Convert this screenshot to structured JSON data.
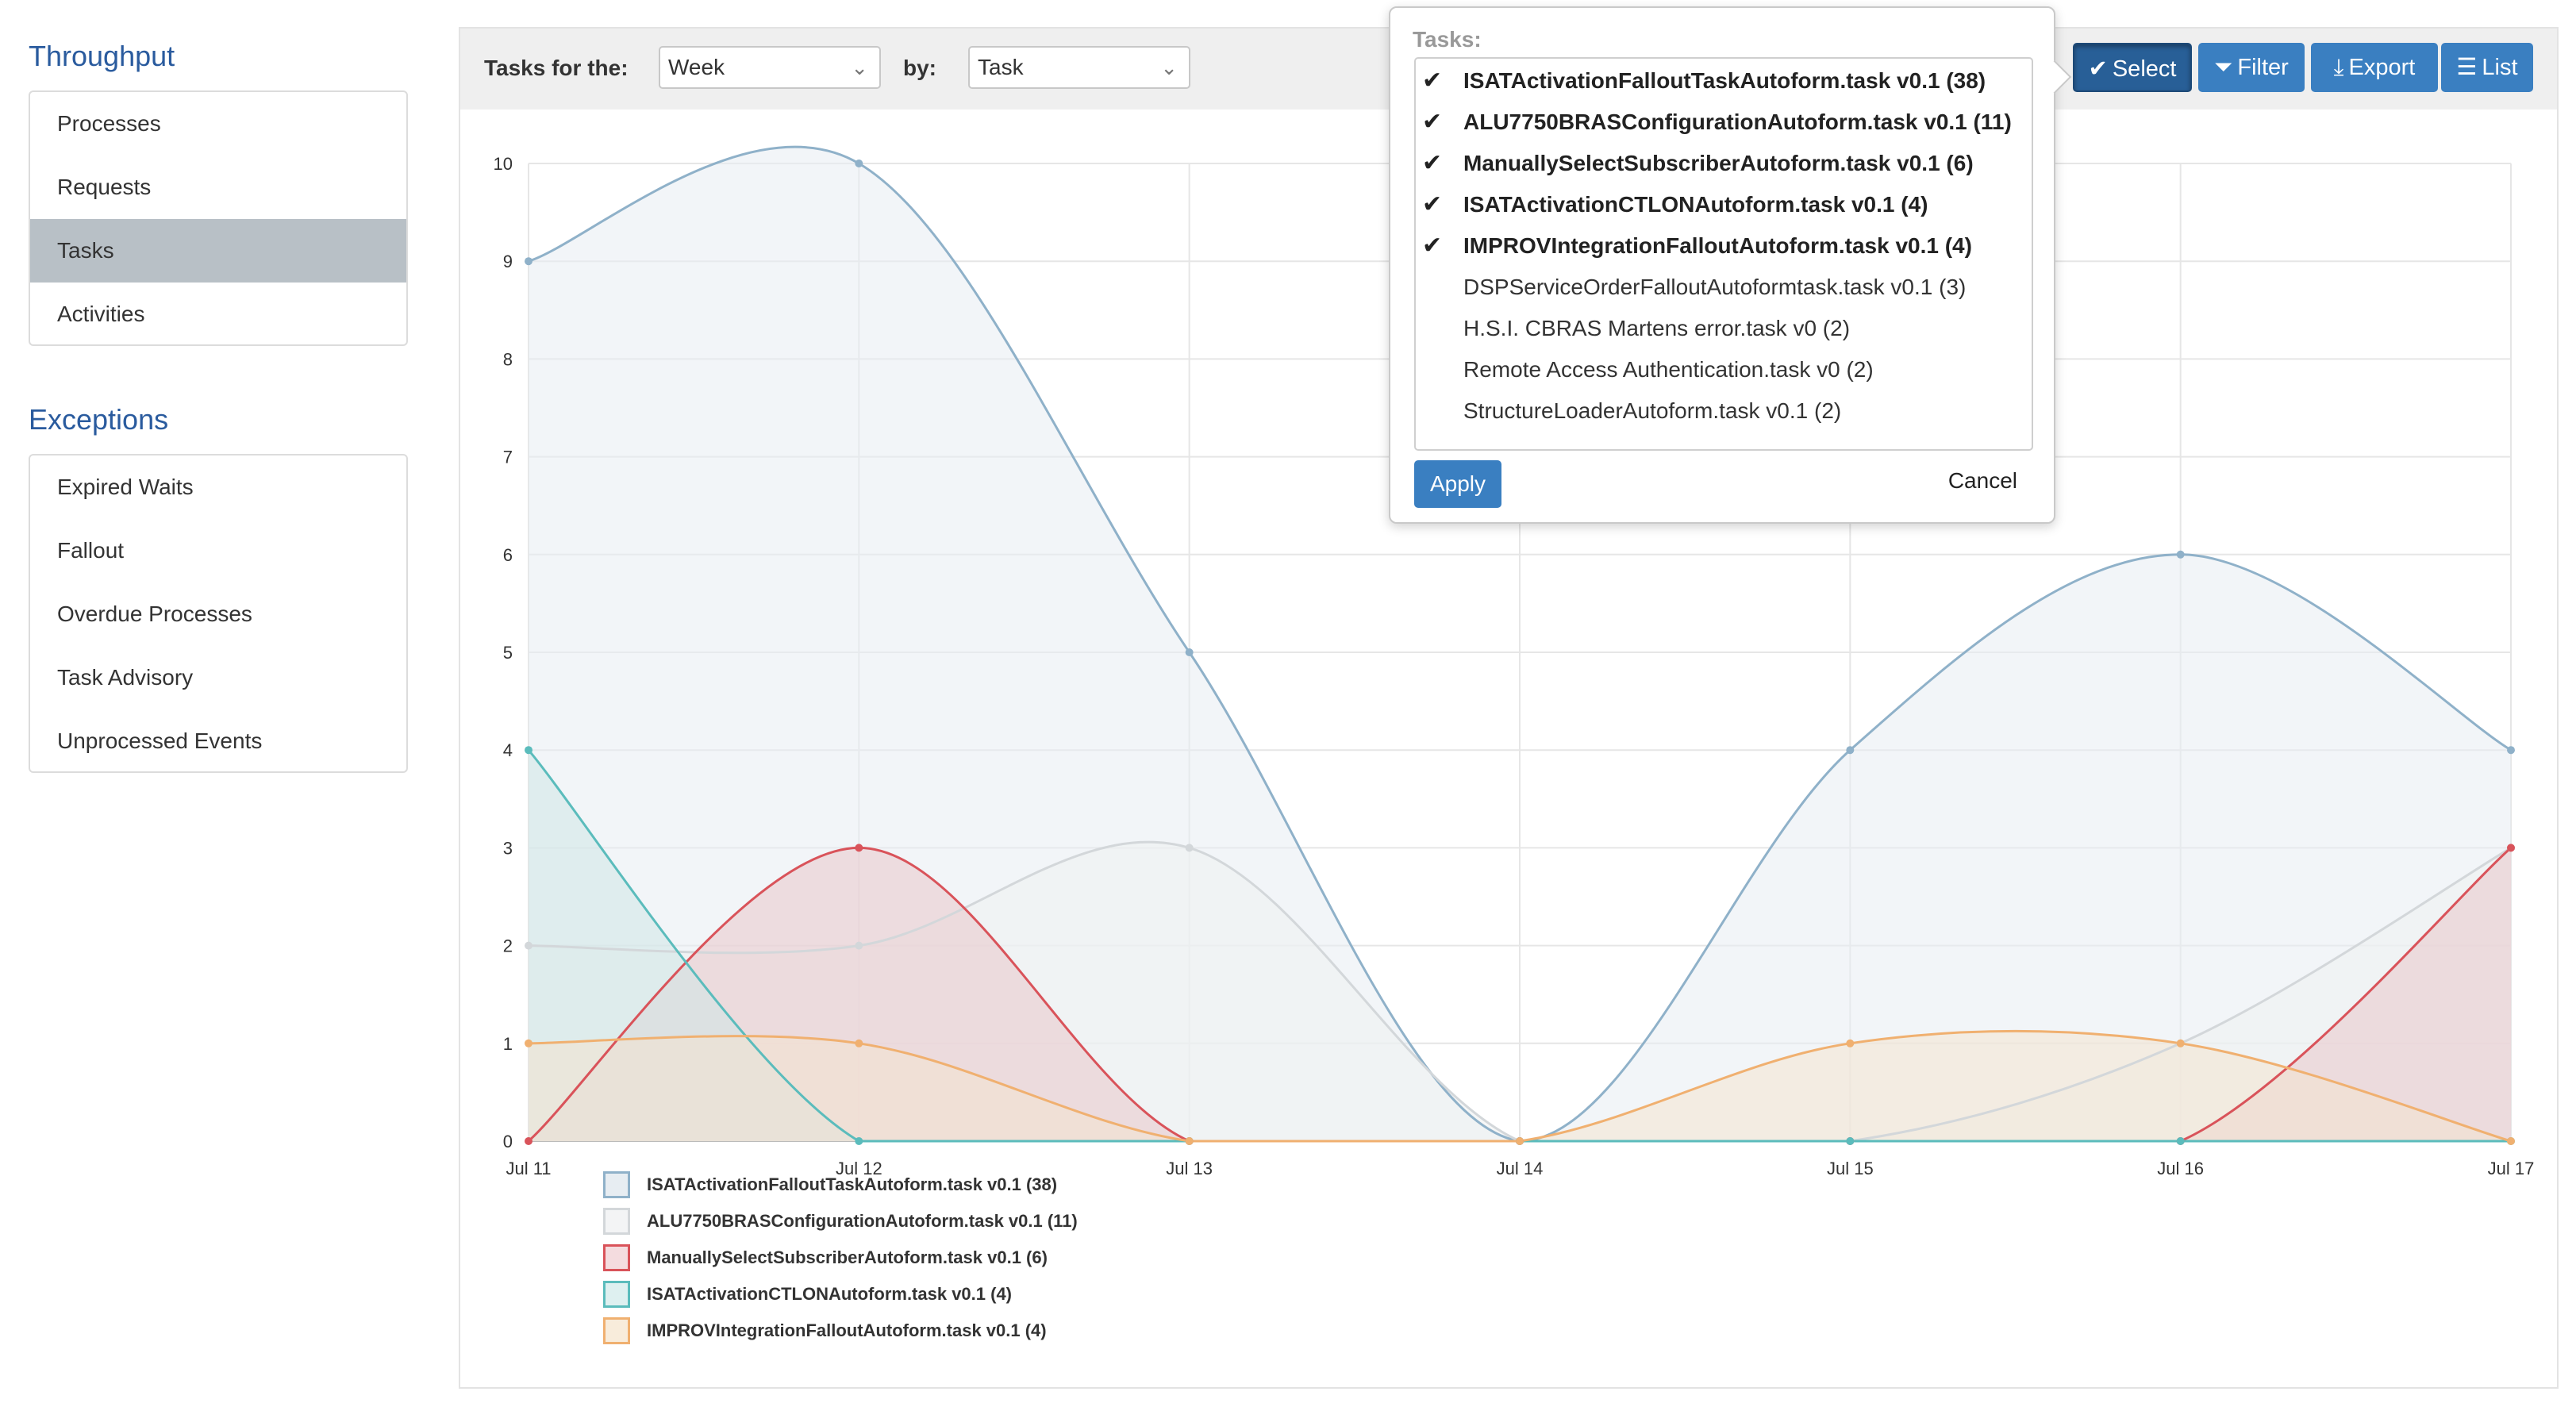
{
  "sidebar": {
    "throughput_title": "Throughput",
    "throughput_items": [
      "Processes",
      "Requests",
      "Tasks",
      "Activities"
    ],
    "active_item": "Tasks",
    "exceptions_title": "Exceptions",
    "exception_items": [
      "Expired Waits",
      "Fallout",
      "Overdue Processes",
      "Task Advisory",
      "Unprocessed Events"
    ]
  },
  "toolbar": {
    "tasks_for_label": "Tasks for the:",
    "period_value": "Week",
    "by_label": "by:",
    "by_value": "Task",
    "buttons": {
      "select": "Select",
      "filter": "Filter",
      "export": "Export",
      "list": "List"
    }
  },
  "popover": {
    "title": "Tasks:",
    "items": [
      {
        "label": "ISATActivationFalloutTaskAutoform.task v0.1 (38)",
        "selected": true
      },
      {
        "label": "ALU7750BRASConfigurationAutoform.task v0.1 (11)",
        "selected": true
      },
      {
        "label": "ManuallySelectSubscriberAutoform.task v0.1 (6)",
        "selected": true
      },
      {
        "label": "ISATActivationCTLONAutoform.task v0.1 (4)",
        "selected": true
      },
      {
        "label": "IMPROVIntegrationFalloutAutoform.task v0.1 (4)",
        "selected": true
      },
      {
        "label": "DSPServiceOrderFalloutAutoformtask.task v0.1 (3)",
        "selected": false
      },
      {
        "label": "H.S.I. CBRAS Martens error.task v0 (2)",
        "selected": false
      },
      {
        "label": "Remote Access Authentication.task v0 (2)",
        "selected": false
      },
      {
        "label": "StructureLoaderAutoform.task v0.1 (2)",
        "selected": false
      }
    ],
    "apply": "Apply",
    "cancel": "Cancel"
  },
  "chart_data": {
    "type": "area",
    "categories": [
      "Jul 11",
      "Jul 12",
      "Jul 13",
      "Jul 14",
      "Jul 15",
      "Jul 16",
      "Jul 17"
    ],
    "ylim": [
      0,
      10
    ],
    "yticks": [
      0,
      1,
      2,
      3,
      4,
      5,
      6,
      7,
      8,
      9,
      10
    ],
    "grid": true,
    "legend_position": "bottom-left",
    "series": [
      {
        "name": "ISATActivationFalloutTaskAutoform.task v0.1 (38)",
        "values": [
          9,
          10,
          5,
          0,
          4,
          6,
          4
        ],
        "color": "#8fb1c9",
        "fill": "#e7edf2"
      },
      {
        "name": "ALU7750BRASConfigurationAutoform.task v0.1 (11)",
        "values": [
          2,
          2,
          3,
          0,
          0,
          1,
          3
        ],
        "color": "#d3d7da",
        "fill": "#eef0f1"
      },
      {
        "name": "ManuallySelectSubscriberAutoform.task v0.1 (6)",
        "values": [
          0,
          3,
          0,
          0,
          0,
          0,
          3
        ],
        "color": "#d9535a",
        "fill": "#eac6cb"
      },
      {
        "name": "ISATActivationCTLONAutoform.task v0.1 (4)",
        "values": [
          4,
          0,
          0,
          0,
          0,
          0,
          0
        ],
        "color": "#5bbcbc",
        "fill": "#cfe6e6"
      },
      {
        "name": "IMPROVIntegrationFalloutAutoform.task v0.1 (4)",
        "values": [
          1,
          1,
          0,
          0,
          1,
          1,
          0
        ],
        "color": "#f0b070",
        "fill": "#f4e4cf"
      }
    ]
  }
}
